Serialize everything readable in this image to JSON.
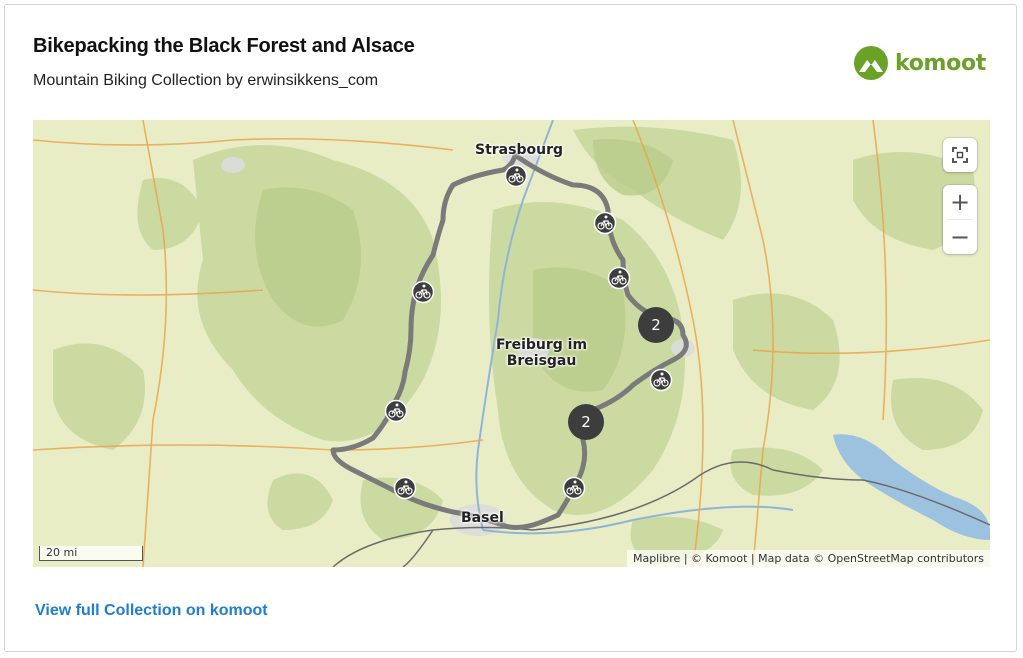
{
  "header": {
    "title": "Bikepacking the Black Forest and Alsace",
    "subtitle": "Mountain Biking Collection by erwinsikkens_com",
    "logo_text": "komoot",
    "logo_color": "#6aa127"
  },
  "map": {
    "labels": {
      "strasbourg": "Strasbourg",
      "freiburg_line1": "Freiburg im",
      "freiburg_line2": "Breisgau",
      "basel": "Basel"
    },
    "clusters": [
      "2",
      "2"
    ],
    "markers": [
      "mountain-bike-icon"
    ],
    "scale": "20 mi",
    "attribution": "Maplibre | © Komoot | Map data © OpenStreetMap contributors",
    "route_color": "#7a7a7a",
    "controls": {
      "fullscreen": "fullscreen-icon",
      "zoom_in": "+",
      "zoom_out": "−"
    }
  },
  "footer": {
    "link": "View full Collection on komoot",
    "link_color": "#1e7fd1"
  }
}
